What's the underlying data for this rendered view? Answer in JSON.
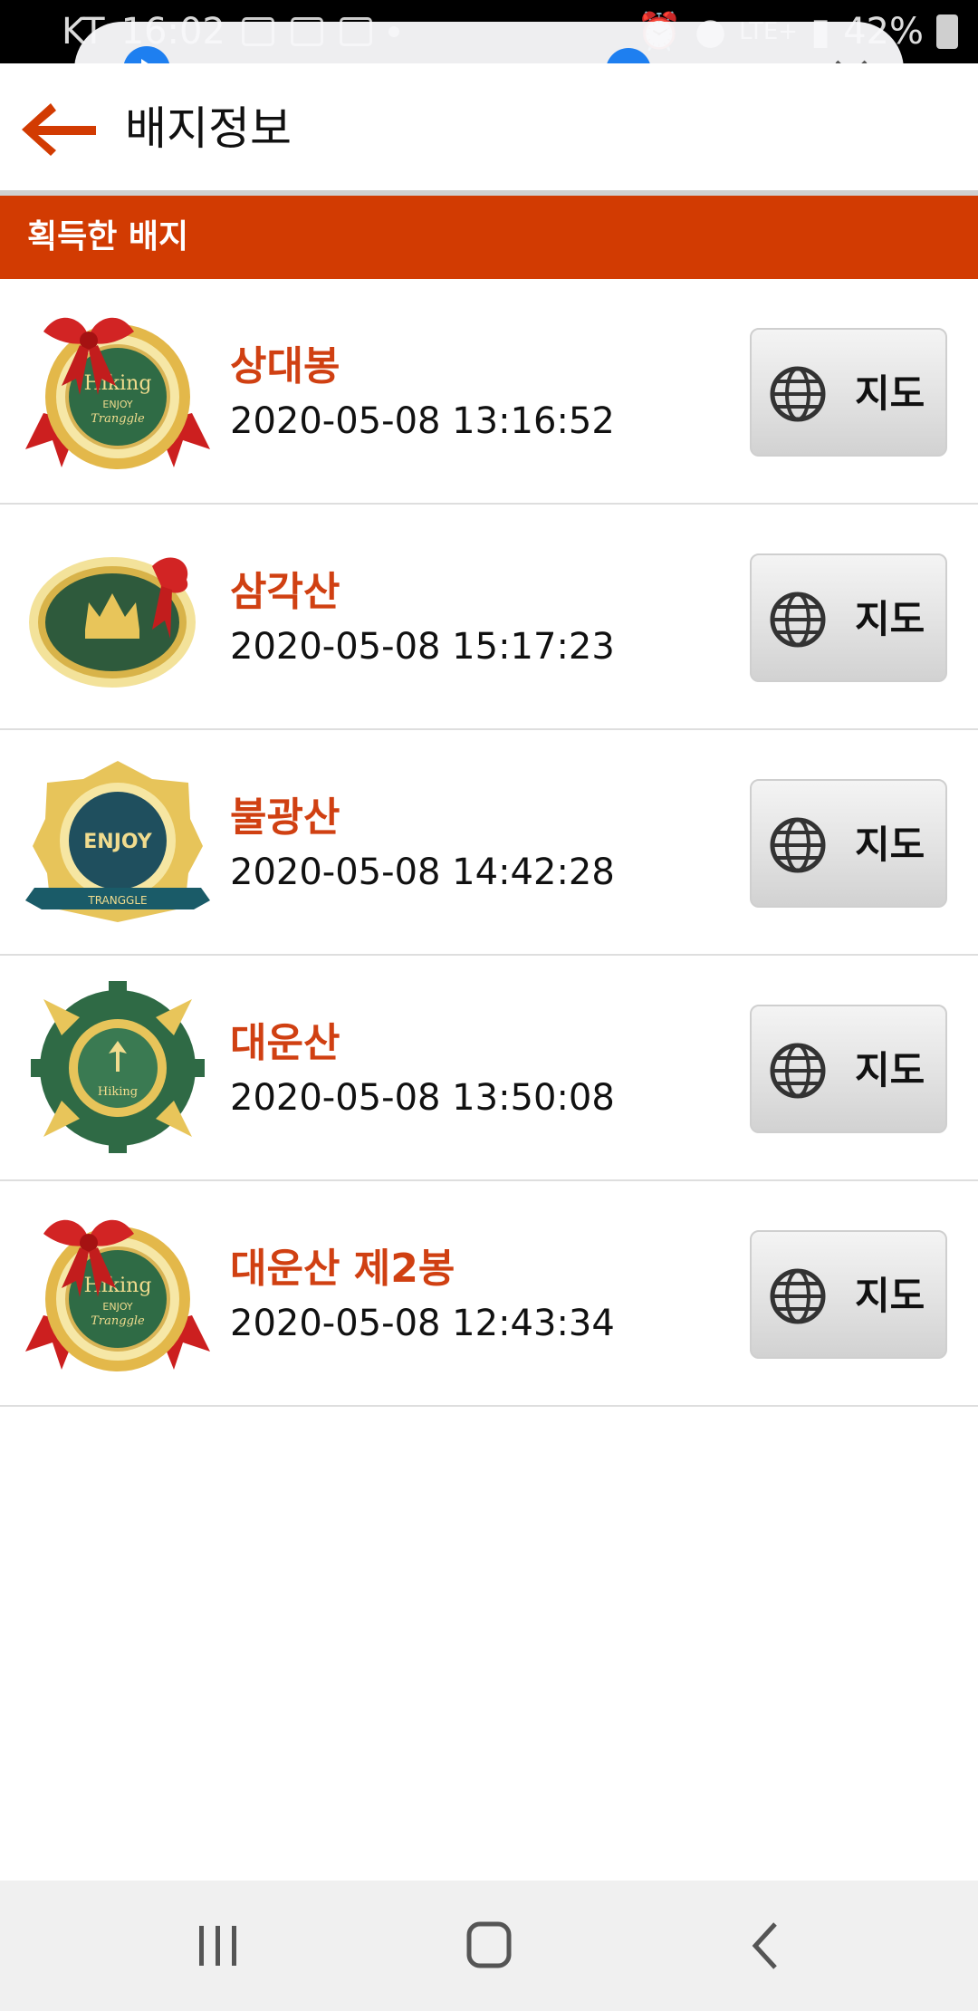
{
  "status_bar": {
    "carrier": "KT",
    "time": "16:02",
    "network": "LTE+",
    "battery": "42%"
  },
  "media": {
    "progress": 0.66
  },
  "header": {
    "title": "배지정보"
  },
  "section": {
    "title": "획득한 배지"
  },
  "badges": [
    {
      "name": "상대봉",
      "time": "2020-05-08 13:16:52",
      "map_label": "지도",
      "badge_style": "hiking-ribbon"
    },
    {
      "name": "삼각산",
      "time": "2020-05-08 15:17:23",
      "map_label": "지도",
      "badge_style": "crown-oval"
    },
    {
      "name": "불광산",
      "time": "2020-05-08 14:42:28",
      "map_label": "지도",
      "badge_style": "enjoy-shield"
    },
    {
      "name": "대운산",
      "time": "2020-05-08 13:50:08",
      "map_label": "지도",
      "badge_style": "gear-hiking"
    },
    {
      "name": "대운산 제2봉",
      "time": "2020-05-08 12:43:34",
      "map_label": "지도",
      "badge_style": "hiking-ribbon"
    }
  ],
  "colors": {
    "accent": "#d23b02",
    "badge_name": "#d04012",
    "media_blue": "#1e7ff0"
  },
  "icons": {
    "back": "back-arrow-icon",
    "map": "globe-icon",
    "nav_recents": "recent-apps-icon",
    "nav_home": "home-icon",
    "nav_back": "nav-back-icon"
  }
}
